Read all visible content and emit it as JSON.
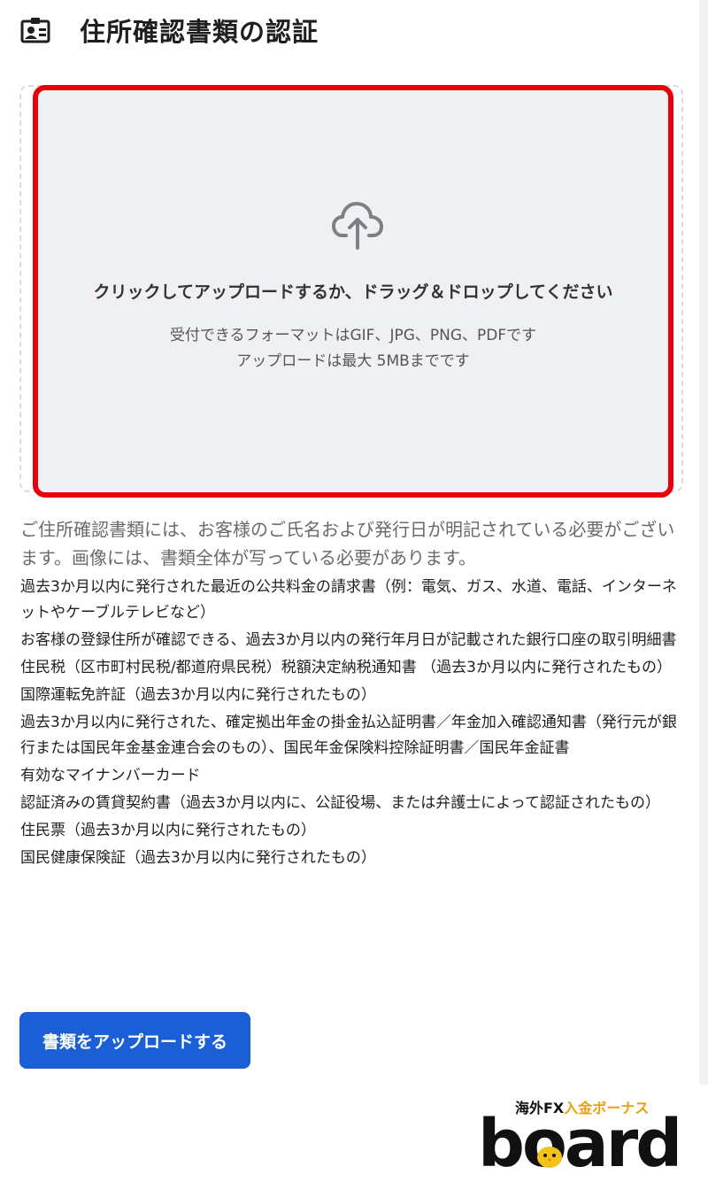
{
  "header": {
    "title": "住所確認書類の認証",
    "icon": "id-card-icon"
  },
  "dropzone": {
    "icon": "cloud-upload-icon",
    "title": "クリックしてアップロードするか、ドラッグ＆ドロップしてください",
    "formats": "受付できるフォーマットはGIF、JPG、PNG、PDFです",
    "max_size": "アップロードは最大 5MBまでです",
    "highlight_color": "#e8000b"
  },
  "intro": "ご住所確認書類には、お客様のご氏名および発行日が明記されている必要がございます。画像には、書類全体が写っている必要があります。",
  "documents": [
    "過去3か月以内に発行された最近の公共料金の請求書（例：電気、ガス、水道、電話、インターネットやケーブルテレビなど）",
    "お客様の登録住所が確認できる、過去3か月以内の発行年月日が記載された銀行口座の取引明細書",
    "住民税（区市町村民税/都道府県民税）税額決定納税通知書 （過去3か月以内に発行されたもの）",
    "国際運転免許証（過去3か月以内に発行されたもの）",
    "過去3か月以内に発行された、確定拠出年金の掛金払込証明書／年金加入確認通知書（発行元が銀行または国民年金基金連合会のもの）、国民年金保険料控除証明書／国民年金証書",
    "有効なマイナンバーカード",
    "認証済みの賃貸契約書（過去3か月以内に、公証役場、または弁護士によって認証されたもの）",
    "住民票（過去3か月以内に発行されたもの）",
    "国民健康保険証（過去3か月以内に発行されたもの）"
  ],
  "upload_button": {
    "label": "書類をアップロードする",
    "color": "#1a5fd6"
  },
  "logo": {
    "tag_part1": "海外FX",
    "tag_part2": "入金ボーナス",
    "word": "board"
  }
}
